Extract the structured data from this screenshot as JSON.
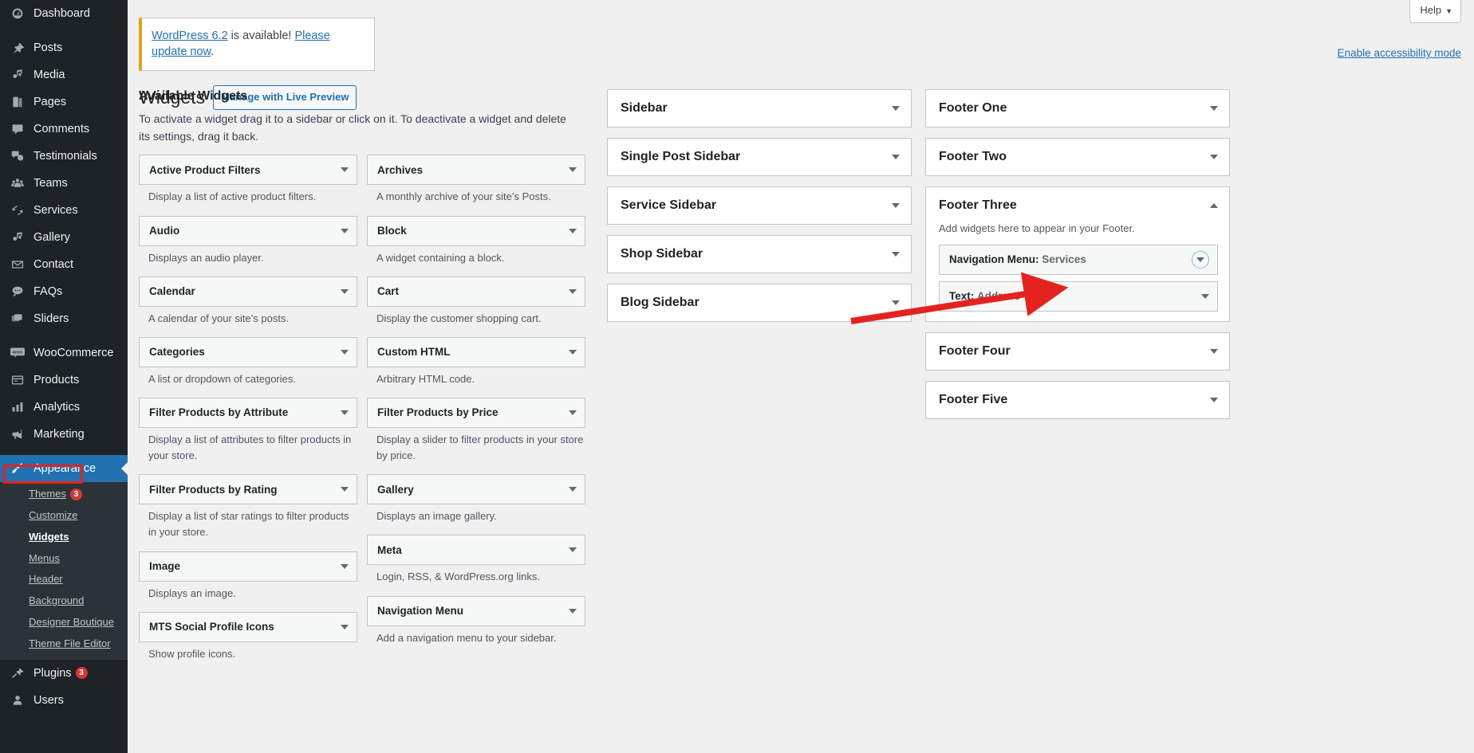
{
  "sidebar": {
    "items": [
      {
        "label": "Dashboard",
        "icon": "dashboard-icon",
        "gap": false
      },
      {
        "label": "Posts",
        "icon": "pin-icon",
        "gap": true
      },
      {
        "label": "Media",
        "icon": "media-icon",
        "gap": false
      },
      {
        "label": "Pages",
        "icon": "pages-icon",
        "gap": false
      },
      {
        "label": "Comments",
        "icon": "comments-icon",
        "gap": false
      },
      {
        "label": "Testimonials",
        "icon": "testimonials-icon",
        "gap": false
      },
      {
        "label": "Teams",
        "icon": "teams-icon",
        "gap": false
      },
      {
        "label": "Services",
        "icon": "services-icon",
        "gap": false
      },
      {
        "label": "Gallery",
        "icon": "gallery-icon",
        "gap": false
      },
      {
        "label": "Contact",
        "icon": "mail-icon",
        "gap": false
      },
      {
        "label": "FAQs",
        "icon": "faq-icon",
        "gap": false
      },
      {
        "label": "Sliders",
        "icon": "sliders-icon",
        "gap": false
      },
      {
        "label": "WooCommerce",
        "icon": "woocommerce-icon",
        "gap": true
      },
      {
        "label": "Products",
        "icon": "products-icon",
        "gap": false
      },
      {
        "label": "Analytics",
        "icon": "analytics-icon",
        "gap": false
      },
      {
        "label": "Marketing",
        "icon": "marketing-icon",
        "gap": false
      }
    ],
    "appearance": {
      "label": "Appearance",
      "icon": "brush-icon"
    },
    "appearance_submenu": [
      {
        "label": "Themes",
        "badge": "3",
        "current": false
      },
      {
        "label": "Customize",
        "badge": "",
        "current": false
      },
      {
        "label": "Widgets",
        "badge": "",
        "current": true
      },
      {
        "label": "Menus",
        "badge": "",
        "current": false
      },
      {
        "label": "Header",
        "badge": "",
        "current": false
      },
      {
        "label": "Background",
        "badge": "",
        "current": false
      },
      {
        "label": "Designer Boutique",
        "badge": "",
        "current": false
      },
      {
        "label": "Theme File Editor",
        "badge": "",
        "current": false
      }
    ],
    "after": [
      {
        "label": "Plugins",
        "icon": "plug-icon",
        "badge": "3"
      },
      {
        "label": "Users",
        "icon": "users-icon",
        "badge": ""
      }
    ]
  },
  "header": {
    "help_label": "Help",
    "accessibility_link": "Enable accessibility mode",
    "notice": {
      "link1": "WordPress 6.2",
      "mid": " is available! ",
      "link2": "Please update now",
      "end": "."
    },
    "page_title": "Widgets",
    "live_preview_button": "Manage with Live Preview"
  },
  "available": {
    "title": "Available Widgets",
    "description": "To activate a widget drag it to a sidebar or click on it. To deactivate a widget and delete its settings, drag it back.",
    "left_column": [
      {
        "name": "Active Product Filters",
        "desc": "Display a list of active product filters."
      },
      {
        "name": "Audio",
        "desc": "Displays an audio player."
      },
      {
        "name": "Calendar",
        "desc": "A calendar of your site’s posts."
      },
      {
        "name": "Categories",
        "desc": "A list or dropdown of categories."
      },
      {
        "name": "Filter Products by Attribute",
        "desc": "Display a list of attributes to filter products in your store."
      },
      {
        "name": "Filter Products by Rating",
        "desc": "Display a list of star ratings to filter products in your store."
      },
      {
        "name": "Image",
        "desc": "Displays an image."
      },
      {
        "name": "MTS Social Profile Icons",
        "desc": "Show profile icons."
      }
    ],
    "right_column": [
      {
        "name": "Archives",
        "desc": "A monthly archive of your site’s Posts."
      },
      {
        "name": "Block",
        "desc": "A widget containing a block."
      },
      {
        "name": "Cart",
        "desc": "Display the customer shopping cart."
      },
      {
        "name": "Custom HTML",
        "desc": "Arbitrary HTML code."
      },
      {
        "name": "Filter Products by Price",
        "desc": "Display a slider to filter products in your store by price."
      },
      {
        "name": "Gallery",
        "desc": "Displays an image gallery."
      },
      {
        "name": "Meta",
        "desc": "Login, RSS, & WordPress.org links."
      },
      {
        "name": "Navigation Menu",
        "desc": "Add a navigation menu to your sidebar."
      }
    ]
  },
  "sidebars_middle": [
    {
      "title": "Sidebar"
    },
    {
      "title": "Single Post Sidebar"
    },
    {
      "title": "Service Sidebar"
    },
    {
      "title": "Shop Sidebar"
    },
    {
      "title": "Blog Sidebar"
    }
  ],
  "sidebars_right": [
    {
      "title": "Footer One"
    },
    {
      "title": "Footer Two"
    }
  ],
  "footer_three": {
    "title": "Footer Three",
    "note": "Add widgets here to appear in your Footer.",
    "widgets": [
      {
        "type": "Navigation Menu",
        "instance": "Services",
        "highlighted": true
      },
      {
        "type": "Text",
        "instance": "Address",
        "highlighted": false
      }
    ]
  },
  "sidebars_right_after": [
    {
      "title": "Footer Four"
    },
    {
      "title": "Footer Five"
    }
  ],
  "colors": {
    "accent": "#2271b1",
    "sidebar_bg": "#1d2327",
    "annotation": "#e4231f",
    "notice_border": "#dba617",
    "badge": "#d63638"
  }
}
